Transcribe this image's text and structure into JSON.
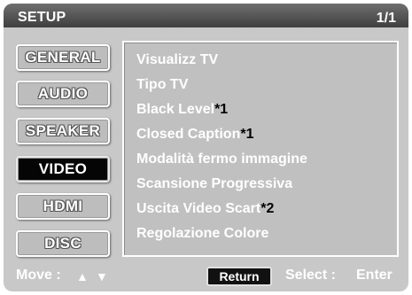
{
  "header": {
    "title": "SETUP",
    "page_indicator": "1/1"
  },
  "tabs": [
    {
      "label": "GENERAL",
      "active": false
    },
    {
      "label": "AUDIO",
      "active": false
    },
    {
      "label": "SPEAKER",
      "active": false
    },
    {
      "label": "VIDEO",
      "active": true
    },
    {
      "label": "HDMI",
      "active": false
    },
    {
      "label": "DISC",
      "active": false
    }
  ],
  "menu": {
    "items": [
      {
        "label": "Visualizz TV",
        "note": ""
      },
      {
        "label": "Tipo TV",
        "note": ""
      },
      {
        "label": "Black Level",
        "note": "*1"
      },
      {
        "label": "Closed Caption",
        "note": "*1"
      },
      {
        "label": "Modalità fermo immagine",
        "note": ""
      },
      {
        "label": "Scansione Progressiva",
        "note": ""
      },
      {
        "label": "Uscita Video Scart",
        "note": "*2"
      },
      {
        "label": "Regolazione Colore",
        "note": ""
      }
    ]
  },
  "footer": {
    "move_label": "Move :",
    "up_icon": "▲",
    "down_icon": "▼",
    "return_label": "Return",
    "select_label": "Select :",
    "enter_label": "Enter"
  },
  "colors": {
    "background": "#c8c8c8",
    "titlebar": "#4a4a4a",
    "active_tab": "#050505",
    "text": "#ffffff"
  }
}
